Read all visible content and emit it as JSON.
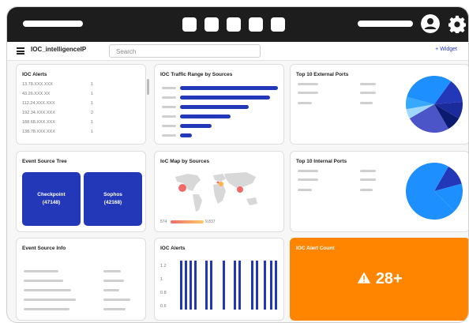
{
  "workspace": {
    "title": "IOC_intelligenceIP",
    "search_placeholder": "Search",
    "add_widget": "+ Widget"
  },
  "colors": {
    "accent": "#2338b8",
    "alert": "#ff8500",
    "topbar": "#1d1d1d"
  },
  "ioc_alerts_list": {
    "title": "IOC Alerts",
    "rows": [
      {
        "ip": "13.78.XXX.XXX",
        "count": "1"
      },
      {
        "ip": "43.26.XXX.XX",
        "count": "1"
      },
      {
        "ip": "112.24.XXX.XXX",
        "count": "1"
      },
      {
        "ip": "192.34.XXX.XXX",
        "count": "2"
      },
      {
        "ip": "188.68.XXX.XXX",
        "count": "1"
      },
      {
        "ip": "138.78.XXX.XXX",
        "count": "1"
      }
    ]
  },
  "traffic_range": {
    "title": "IOC Traffic Range by Sources",
    "relative_values": [
      1.0,
      0.92,
      0.7,
      0.52,
      0.32,
      0.12
    ]
  },
  "external_ports": {
    "title": "Top 10 External Ports"
  },
  "internal_ports": {
    "title": "Top 10 Internal Ports"
  },
  "event_source_tree": {
    "title": "Event Source Tree",
    "nodes": [
      {
        "name": "Checkpoint",
        "count": "(47148)"
      },
      {
        "name": "Sophos",
        "count": "(42168)"
      }
    ]
  },
  "ioc_map": {
    "title": "IoC Map by Sources",
    "legend_min": "574",
    "legend_max": "9,837"
  },
  "event_source_info": {
    "title": "Event Source Info"
  },
  "ioc_alerts_chart": {
    "title": "IOC Alerts",
    "y_ticks": [
      "1.2",
      "1",
      "0.8",
      "0.6"
    ]
  },
  "ioc_alert_count": {
    "title": "IOC Alert Count",
    "value": "28+",
    "icon": "warning-icon"
  }
}
